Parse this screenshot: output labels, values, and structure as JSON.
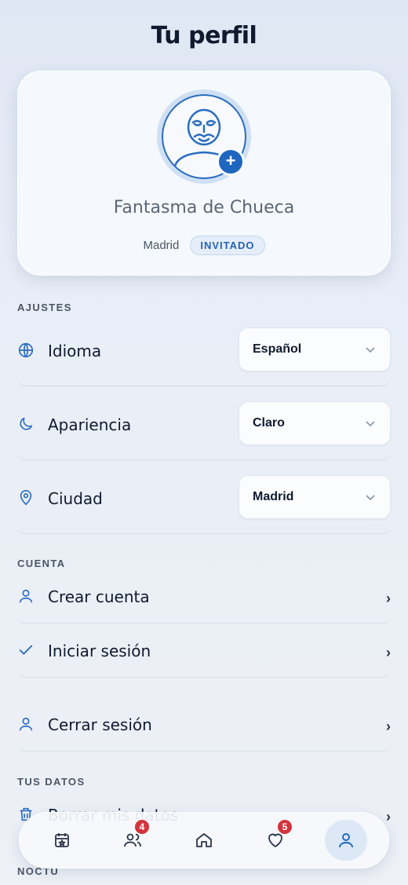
{
  "page": {
    "title": "Tu perfil"
  },
  "profile": {
    "name": "Fantasma de Chueca",
    "city": "Madrid",
    "role": "INVITADO",
    "add_photo_symbol": "+"
  },
  "settings": {
    "header": "AJUSTES",
    "items": [
      {
        "icon": "globe-icon",
        "label": "Idioma",
        "value": "Español"
      },
      {
        "icon": "moon-icon",
        "label": "Apariencia",
        "value": "Claro"
      },
      {
        "icon": "location-pin-icon",
        "label": "Ciudad",
        "value": "Madrid"
      }
    ]
  },
  "account": {
    "header": "CUENTA",
    "items": [
      {
        "icon": "user-icon",
        "label": "Crear cuenta"
      },
      {
        "icon": "check-icon",
        "label": "Iniciar sesión"
      },
      {
        "icon": "user-icon",
        "label": "Cerrar sesión"
      }
    ]
  },
  "data_section": {
    "header": "TUS DATOS",
    "items": [
      {
        "icon": "trash-icon",
        "label": "Borrar mis datos"
      }
    ]
  },
  "noctu_section": {
    "header": "NOCTU"
  },
  "chevron": "›",
  "nav": {
    "items": [
      {
        "icon": "calendar-icon"
      },
      {
        "icon": "people-icon",
        "badge": "4"
      },
      {
        "icon": "home-icon"
      },
      {
        "icon": "heart-icon",
        "badge": "5"
      },
      {
        "icon": "profile-icon",
        "active": true
      }
    ]
  },
  "colors": {
    "accent": "#1f66c0",
    "badge": "#d4343c",
    "text": "#0f1a2e"
  }
}
